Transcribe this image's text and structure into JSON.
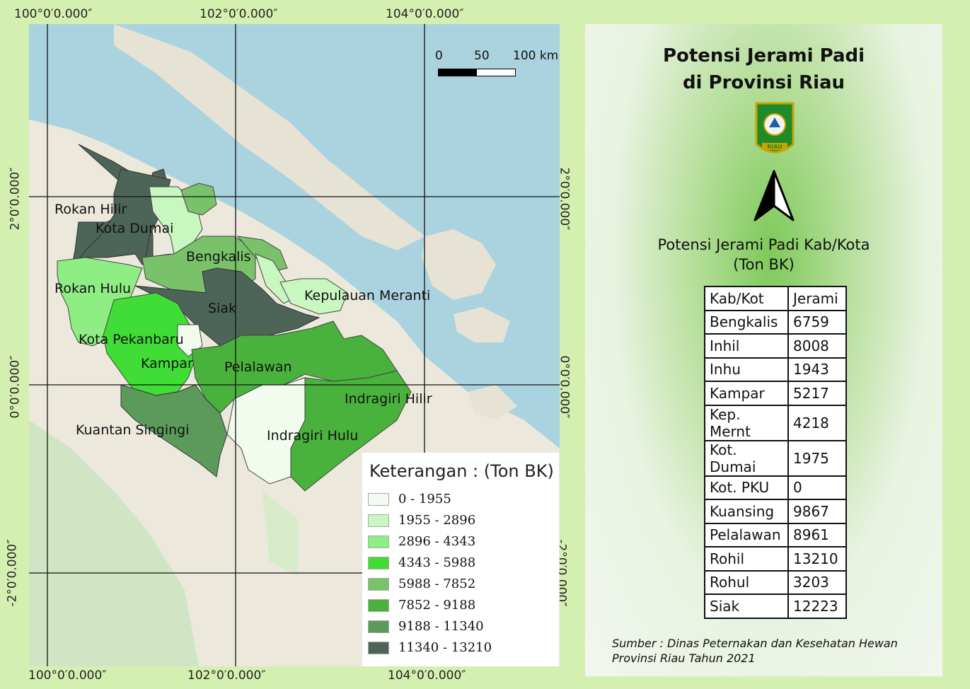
{
  "map": {
    "coord_labels": {
      "top": [
        "100°0′0.000″",
        "102°0′0.000″",
        "104°0′0.000″"
      ],
      "bottom": [
        "100°0′0.000″",
        "102°0′0.000″",
        "104°0′0.000″"
      ],
      "left": [
        "2°0′0.000″",
        "0°0′0.000″",
        "-2°0′0.000″"
      ],
      "right": [
        "2°0′0.000″",
        "0°0′0.000″",
        "-2°0′0.000″"
      ]
    },
    "scalebar": {
      "ticks": [
        "0",
        "50",
        "100 km"
      ]
    },
    "regions": [
      {
        "name": "Rokan Hilir",
        "value": 13210
      },
      {
        "name": "Kota Dumai",
        "value": 1975
      },
      {
        "name": "Bengkalis",
        "value": 6759
      },
      {
        "name": "Rokan Hulu",
        "value": 3203
      },
      {
        "name": "Siak",
        "value": 12223
      },
      {
        "name": "Kepulauan Meranti",
        "value": 4218
      },
      {
        "name": "Kota Pekanbaru",
        "value": 0
      },
      {
        "name": "Kampar",
        "value": 5217
      },
      {
        "name": "Pelalawan",
        "value": 8961
      },
      {
        "name": "Indragiri Hilir",
        "value": 8008
      },
      {
        "name": "Kuantan Singingi",
        "value": 9867
      },
      {
        "name": "Indragiri Hulu",
        "value": 1943
      }
    ],
    "legend": {
      "title": "Keterangan : (Ton BK)",
      "classes": [
        {
          "label": "0 - 1955",
          "color": "#f1fcef"
        },
        {
          "label": "1955 - 2896",
          "color": "#c8f7c0"
        },
        {
          "label": "2896 - 4343",
          "color": "#8eee84"
        },
        {
          "label": "4343 - 5988",
          "color": "#3fdd35"
        },
        {
          "label": "5988 - 7852",
          "color": "#79c26a"
        },
        {
          "label": "7852 - 9188",
          "color": "#49b23c"
        },
        {
          "label": "9188 - 11340",
          "color": "#5c9a5c"
        },
        {
          "label": "11340 - 13210",
          "color": "#4c6558"
        }
      ]
    }
  },
  "panel": {
    "title_line1": "Potensi Jerami Padi",
    "title_line2": "di Provinsi Riau",
    "logo_text": "RIAU",
    "north_arrow": "north-arrow",
    "subtitle_line1": "Potensi Jerami Padi Kab/Kota",
    "subtitle_line2": "(Ton BK)",
    "table": {
      "headers": [
        "Kab/Kot",
        "Jerami"
      ],
      "rows": [
        [
          "Bengkalis",
          "6759"
        ],
        [
          "Inhil",
          "8008"
        ],
        [
          "Inhu",
          "1943"
        ],
        [
          "Kampar",
          "5217"
        ],
        [
          "Kep. Mernt",
          "4218"
        ],
        [
          "Kot. Dumai",
          "1975"
        ],
        [
          "Kot. PKU",
          "0"
        ],
        [
          "Kuansing",
          "9867"
        ],
        [
          "Pelalawan",
          "8961"
        ],
        [
          "Rohil",
          "13210"
        ],
        [
          "Rohul",
          "3203"
        ],
        [
          "Siak",
          "12223"
        ]
      ]
    },
    "source_line1": "Sumber : Dinas Peternakan dan Kesehatan Hewan",
    "source_line2": "Provinsi Riau Tahun 2021"
  }
}
